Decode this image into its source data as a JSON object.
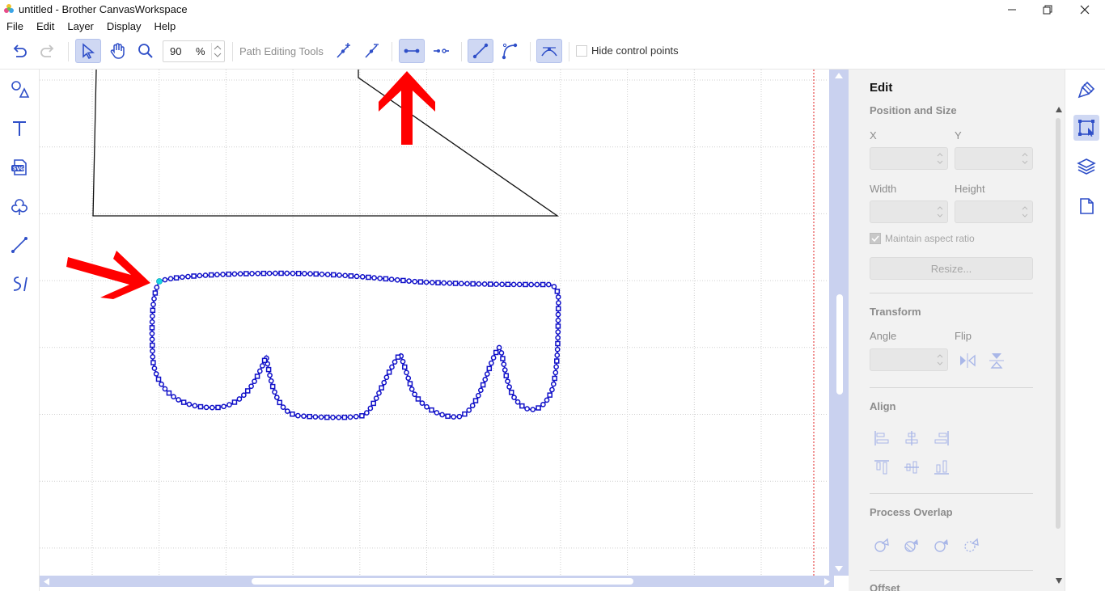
{
  "window": {
    "title": "untitled - Brother CanvasWorkspace",
    "controls": {
      "minimize": "minimize-icon",
      "maximize": "restore-icon",
      "close": "close-icon"
    }
  },
  "menu": [
    "File",
    "Edit",
    "Layer",
    "Display",
    "Help"
  ],
  "toolbar": {
    "zoom_value": "90",
    "zoom_unit": "%",
    "path_tools_label": "Path Editing Tools",
    "hide_control_points_label": "Hide control points",
    "hide_control_points_checked": false,
    "accent_color": "#2f4fc8",
    "active_highlight": "#cfd8f3"
  },
  "left_tools": [
    {
      "name": "shapes-icon"
    },
    {
      "name": "text-icon"
    },
    {
      "name": "svg-import-icon"
    },
    {
      "name": "pattern-icon"
    },
    {
      "name": "line-icon"
    },
    {
      "name": "freehand-icon"
    }
  ],
  "edit_panel": {
    "title": "Edit",
    "position_size": {
      "title": "Position and Size",
      "x_label": "X",
      "y_label": "Y",
      "width_label": "Width",
      "height_label": "Height",
      "maintain_label": "Maintain aspect ratio",
      "maintain_checked": true,
      "resize_label": "Resize..."
    },
    "transform": {
      "title": "Transform",
      "angle_label": "Angle",
      "flip_label": "Flip"
    },
    "align": {
      "title": "Align"
    },
    "process_overlap": {
      "title": "Process Overlap"
    },
    "offset": {
      "title": "Offset"
    }
  },
  "right_tabs": [
    {
      "name": "paint-icon",
      "active": false
    },
    {
      "name": "edit-transform-icon",
      "active": true
    },
    {
      "name": "layers-icon",
      "active": false
    },
    {
      "name": "page-icon",
      "active": false
    }
  ],
  "canvas": {
    "path_color": "#1010c8",
    "selected_node_color": "#19d6e6",
    "annotation_color": "#ff0000"
  }
}
